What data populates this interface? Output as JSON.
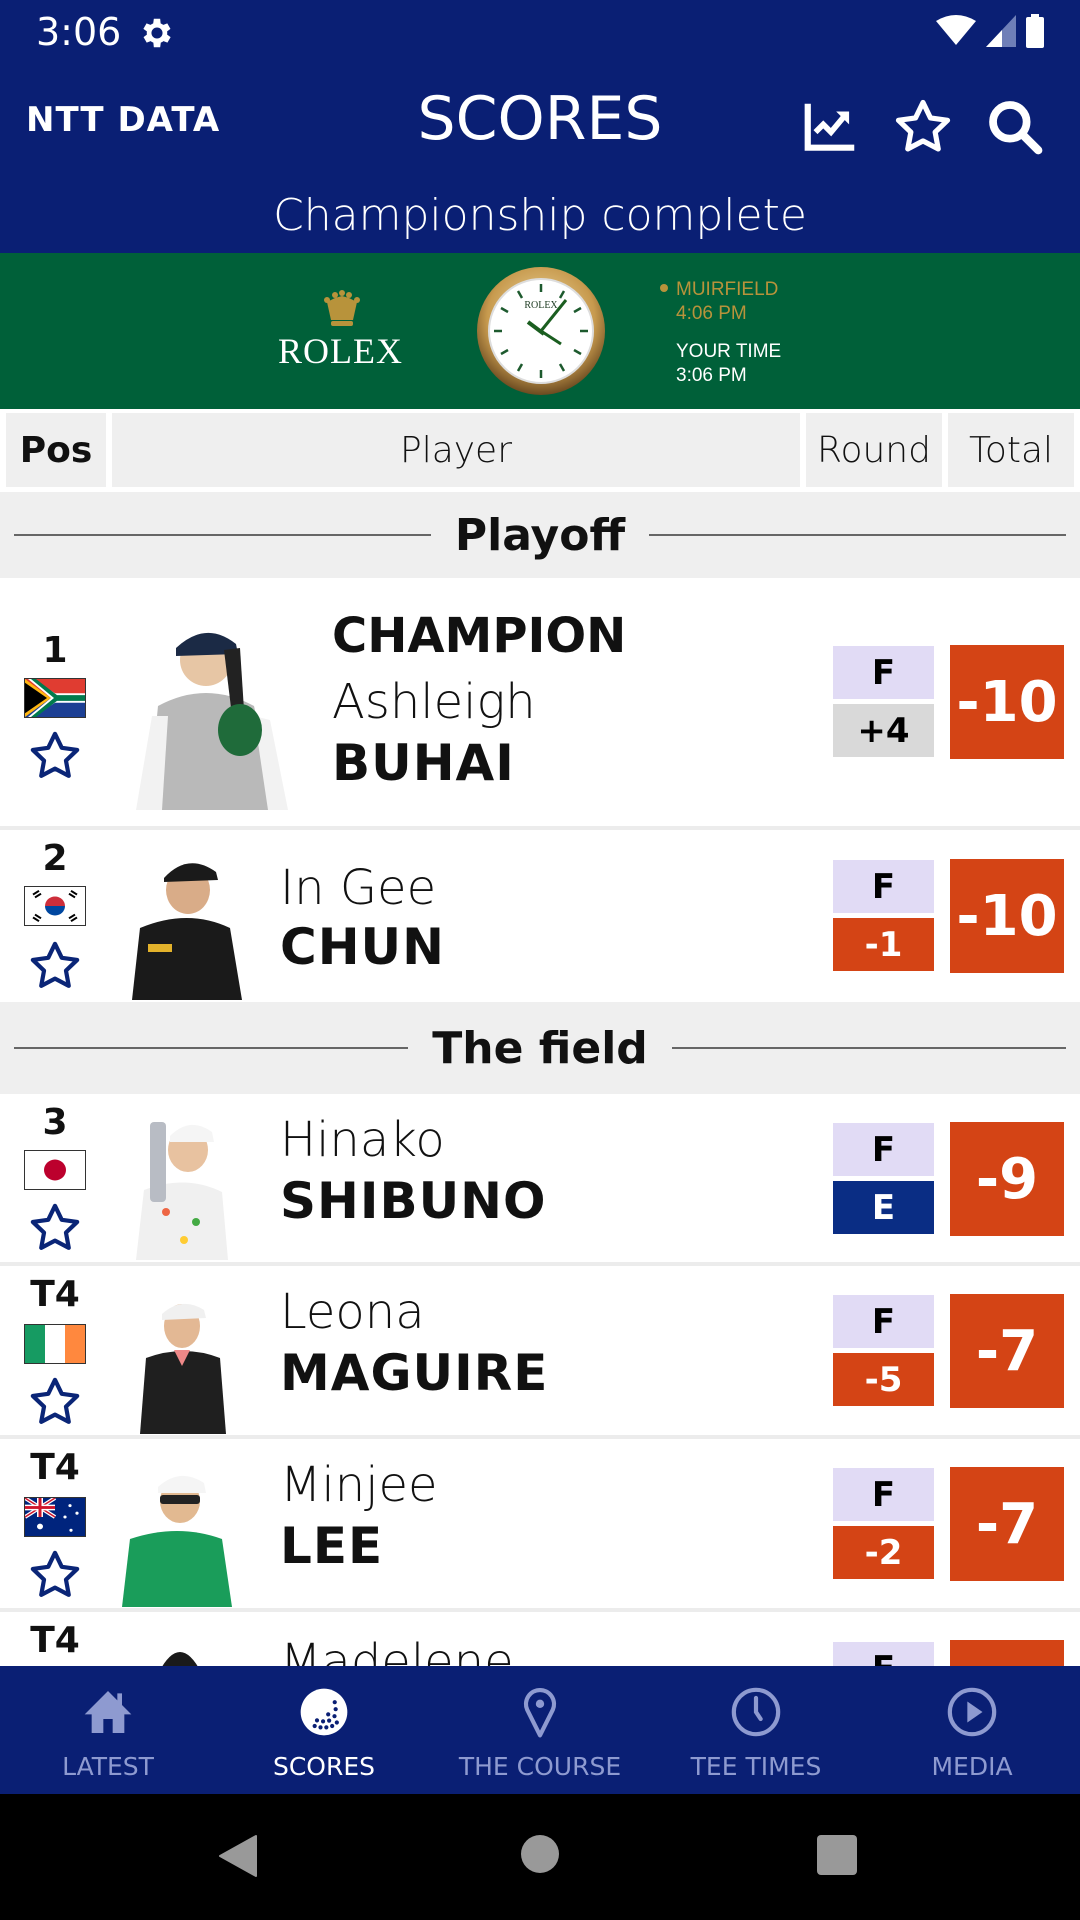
{
  "status_bar": {
    "time": "3:06"
  },
  "header": {
    "logo": "NTT DATA",
    "title": "SCORES",
    "subtitle": "Championship complete",
    "icons": [
      "chart-icon",
      "star-icon",
      "search-icon"
    ]
  },
  "rolex": {
    "brand": "ROLEX",
    "venue_label": "MUIRFIELD",
    "venue_time": "4:06 PM",
    "local_label": "YOUR TIME",
    "local_time": "3:06 PM"
  },
  "columns": {
    "pos": "Pos",
    "player": "Player",
    "round": "Round",
    "total": "Total"
  },
  "sections": {
    "playoff": "Playoff",
    "field": "The field"
  },
  "players": [
    {
      "pos": "1",
      "country": "South Africa",
      "badge": "CHAMPION",
      "first": "Ashleigh",
      "last": "BUHAI",
      "thru": "F",
      "round": "+4",
      "round_style": "over",
      "total": "-10"
    },
    {
      "pos": "2",
      "country": "South Korea",
      "first": "In Gee",
      "last": "CHUN",
      "thru": "F",
      "round": "-1",
      "round_style": "under",
      "total": "-10"
    },
    {
      "pos": "3",
      "country": "Japan",
      "first": "Hinako",
      "last": "SHIBUNO",
      "thru": "F",
      "round": "E",
      "round_style": "even",
      "total": "-9"
    },
    {
      "pos": "T4",
      "country": "Ireland",
      "first": "Leona",
      "last": "MAGUIRE",
      "thru": "F",
      "round": "-5",
      "round_style": "under",
      "total": "-7"
    },
    {
      "pos": "T4",
      "country": "Australia",
      "first": "Minjee",
      "last": "LEE",
      "thru": "F",
      "round": "-2",
      "round_style": "under",
      "total": "-7"
    },
    {
      "pos": "T4",
      "first": "Madelene",
      "thru": "F"
    }
  ],
  "colors": {
    "header_blue": "#0a1f74",
    "rolex_green": "#006039",
    "score_red": "#d44415",
    "thru_lavender": "#e1dbf5",
    "even_blue": "#0a2d84",
    "over_grey": "#d9d9d9",
    "star_blue": "#0a2577"
  },
  "bottom_nav": [
    {
      "label": "LATEST",
      "icon": "home-icon"
    },
    {
      "label": "SCORES",
      "icon": "golf-ball-icon",
      "active": true
    },
    {
      "label": "THE COURSE",
      "icon": "map-pin-icon"
    },
    {
      "label": "TEE TIMES",
      "icon": "clock-icon"
    },
    {
      "label": "MEDIA",
      "icon": "play-icon"
    }
  ]
}
